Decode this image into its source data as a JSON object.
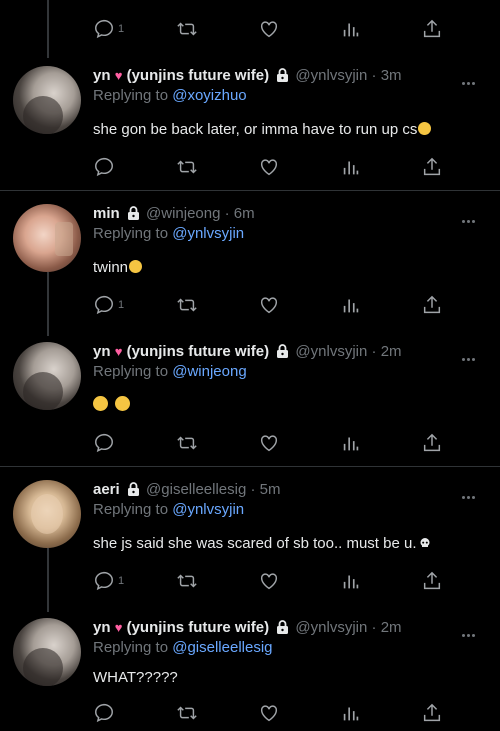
{
  "tweets": [
    {
      "name": "yn",
      "name_suffix": "(yunjins future wife)",
      "handle": "@ynlvsyjin",
      "time": "3m",
      "replying_prefix": "Replying to",
      "replying_to": "@xoyizhuo",
      "text": "she gon be back later, or imma have to run up cs",
      "emoji": "face-with-monocle",
      "reply_count": ""
    },
    {
      "name": "min",
      "handle": "@winjeong",
      "time": "6m",
      "replying_prefix": "Replying to",
      "replying_to": "@ynlvsyjin",
      "text": "twinn",
      "emoji": "squinting-face",
      "reply_count": "1"
    },
    {
      "name": "yn",
      "name_suffix": "(yunjins future wife)",
      "handle": "@ynlvsyjin",
      "time": "2m",
      "replying_prefix": "Replying to",
      "replying_to": "@winjeong",
      "text": "",
      "emoji": "grimacing-faces",
      "reply_count": ""
    },
    {
      "name": "aeri",
      "handle": "@giselleellesig",
      "time": "5m",
      "replying_prefix": "Replying to",
      "replying_to": "@ynlvsyjin",
      "text": "she js said she was scared of sb too.. must be u.",
      "emoji": "skull",
      "reply_count": "1"
    },
    {
      "name": "yn",
      "name_suffix": "(yunjins future wife)",
      "handle": "@ynlvsyjin",
      "time": "2m",
      "replying_prefix": "Replying to",
      "replying_to": "@giselleellesig",
      "text": "WHAT?????",
      "emoji": "",
      "reply_count": ""
    }
  ],
  "top_actions": {
    "reply_count": "1"
  },
  "icons": [
    "reply-icon",
    "retweet-icon",
    "like-icon",
    "views-icon",
    "share-icon",
    "lock-icon",
    "more-icon",
    "heart-emoji-icon"
  ],
  "colors": {
    "background": "#000000",
    "text": "#e7e9ea",
    "muted": "#71767b",
    "mention": "#6aa8ff",
    "divider": "#2f3336",
    "heart": "#ff5fa2"
  }
}
